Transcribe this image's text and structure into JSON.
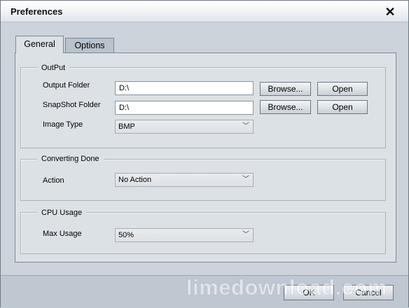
{
  "window": {
    "title": "Preferences"
  },
  "tabs": [
    {
      "label": "General",
      "selected": true
    },
    {
      "label": "Options",
      "selected": false
    }
  ],
  "output": {
    "group_label": "OutPut",
    "output_folder_label": "Output Folder",
    "output_folder_value": "D:\\",
    "snapshot_folder_label": "SnapShot Folder",
    "snapshot_folder_value": "D:\\",
    "image_type_label": "Image Type",
    "image_type_value": "BMP",
    "browse_label": "Browse...",
    "open_label": "Open"
  },
  "converting": {
    "group_label": "Converting Done",
    "action_label": "Action",
    "action_value": "No Action"
  },
  "cpu": {
    "group_label": "CPU Usage",
    "max_usage_label": "Max Usage",
    "max_usage_value": "50%"
  },
  "footer": {
    "ok_label": "OK",
    "cancel_label": "Cancel",
    "watermark": "limedownload.com"
  },
  "icons": {
    "close": "close-icon",
    "dropdown": "chevron-down-icon"
  }
}
